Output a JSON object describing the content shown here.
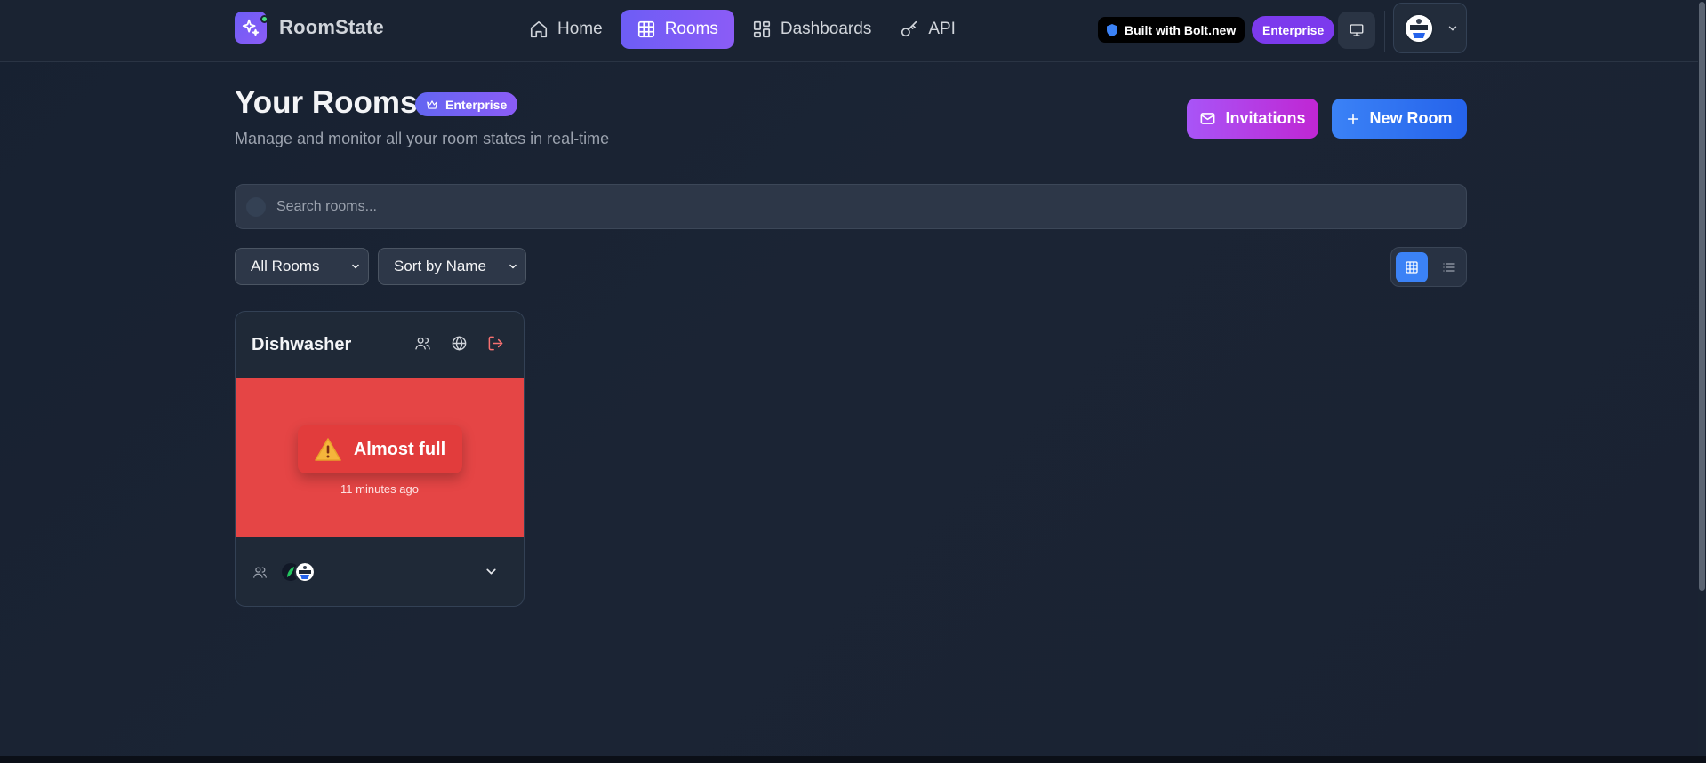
{
  "app": {
    "name": "RoomState"
  },
  "nav": {
    "links": [
      {
        "label": "Home",
        "icon": "home-icon",
        "active": false
      },
      {
        "label": "Rooms",
        "icon": "grid-icon",
        "active": true
      },
      {
        "label": "Dashboards",
        "icon": "dashboard-icon",
        "active": false
      },
      {
        "label": "API",
        "icon": "key-icon",
        "active": false
      }
    ],
    "bolt_badge": "Built with Bolt.new",
    "plan_badge": "Enterprise"
  },
  "header": {
    "title": "Your Rooms",
    "badge": "Enterprise",
    "subtitle": "Manage and monitor all your room states in real-time",
    "invitations_label": "Invitations",
    "new_room_label": "New Room"
  },
  "search": {
    "placeholder": "Search rooms...",
    "value": ""
  },
  "filters": {
    "room_filter": "All Rooms",
    "sort": "Sort by Name",
    "view_mode": "grid"
  },
  "rooms": [
    {
      "name": "Dishwasher",
      "status_label": "Almost full",
      "status_icon": "warning-icon",
      "status_color": "#e54545",
      "updated": "11 minutes ago"
    }
  ],
  "colors": {
    "accent_purple": "#8b5cf6",
    "accent_blue": "#3b82f6",
    "status_red": "#e54545",
    "background": "#1b2434"
  }
}
